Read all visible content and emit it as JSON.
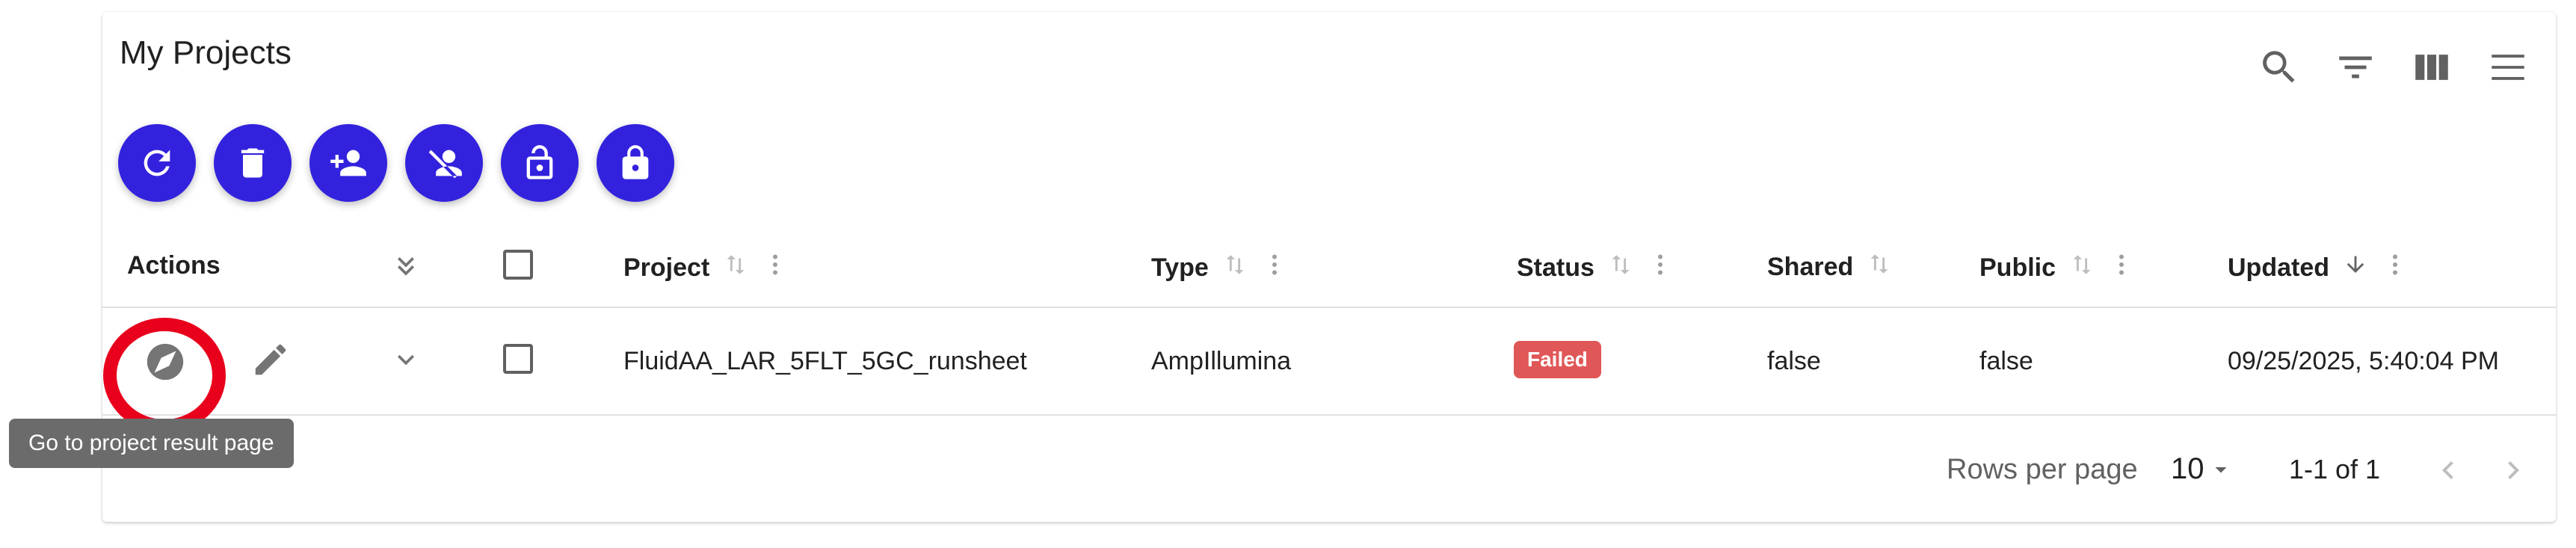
{
  "card": {
    "title": "My Projects"
  },
  "toolbar": {
    "icons": [
      "search-icon",
      "filter-icon",
      "columns-icon",
      "menu-icon"
    ],
    "fab_buttons": [
      "refresh-icon",
      "delete-icon",
      "add-person-icon",
      "remove-person-icon",
      "unlock-icon",
      "lock-icon"
    ],
    "accent_color": "#3322dd"
  },
  "table": {
    "headers": {
      "actions": "Actions",
      "project": "Project",
      "type": "Type",
      "status": "Status",
      "shared": "Shared",
      "public": "Public",
      "updated": "Updated"
    },
    "rows": [
      {
        "project": "FluidAA_LAR_5FLT_5GC_runsheet",
        "type": "AmpIllumina",
        "status": "Failed",
        "shared": "false",
        "public": "false",
        "updated": "09/25/2025, 5:40:04 PM"
      }
    ]
  },
  "tooltip": {
    "text": "Go to project result page"
  },
  "footer": {
    "rows_per_page_label": "Rows per page",
    "rows_per_page_value": "10",
    "range": "1-1 of 1"
  },
  "colors": {
    "status_failed": "#e05757",
    "highlight_ring": "#e8001c"
  }
}
